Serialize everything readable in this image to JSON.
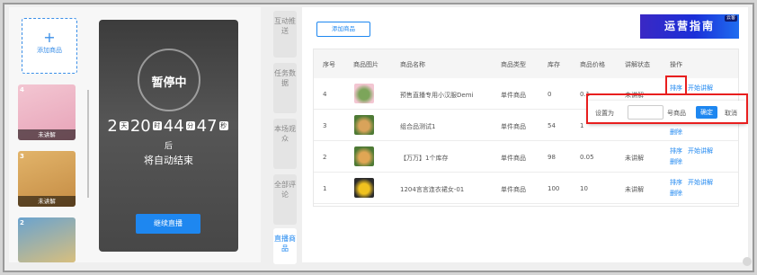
{
  "left": {
    "add_product_label": "添加商品",
    "items": [
      {
        "number": "4",
        "status": "未讲解",
        "color_a": "#f3c6d2",
        "color_b": "#e7a3b8"
      },
      {
        "number": "3",
        "status": "未讲解",
        "color_a": "#e2b46a",
        "color_b": "#c58c44"
      },
      {
        "number": "2",
        "status": "",
        "color_a": "#6aa3cf",
        "color_b": "#d8bf7e"
      }
    ]
  },
  "live": {
    "paused_text": "暂停中",
    "countdown": {
      "days": "2",
      "day_unit": "天",
      "hours": "20",
      "hour_unit": "时",
      "minutes": "44",
      "minute_unit": "分",
      "seconds": "47",
      "second_unit": "秒"
    },
    "after_text": "后",
    "auto_end_text": "将自动结束",
    "resume_button": "继续直播"
  },
  "tabs": [
    {
      "label": "互动推送",
      "active": false
    },
    {
      "label": "任务数据",
      "active": false
    },
    {
      "label": "本场观众",
      "active": false
    },
    {
      "label": "全部评论",
      "active": false
    },
    {
      "label": "直播商品",
      "active": true
    }
  ],
  "toolbar": {
    "add_product_button": "添加商品"
  },
  "guide_banner": {
    "text": "运营指南",
    "tag": "云客"
  },
  "table": {
    "headers": [
      "序号",
      "商品图片",
      "商品名称",
      "商品类型",
      "库存",
      "商品价格",
      "讲解状态",
      "操作"
    ],
    "rows": [
      {
        "index": "4",
        "name": "预售直播专用小汉服Demi",
        "type": "单件商品",
        "stock": "0",
        "price": "0.1",
        "status": "未讲解",
        "sort_label": "排序",
        "explain_label": "开始讲解",
        "delete_label": "",
        "img_a": "#f3c6d2",
        "img_b": "#7ca55a"
      },
      {
        "index": "3",
        "name": "组合品测试1",
        "type": "单件商品",
        "stock": "54",
        "price": "1",
        "status": "",
        "sort_label": "",
        "explain_label": "",
        "delete_label": "删除",
        "img_a": "#4e7a35",
        "img_b": "#d9a35a"
      },
      {
        "index": "2",
        "name": "【万万】1个库存",
        "type": "单件商品",
        "stock": "98",
        "price": "0.05",
        "status": "未讲解",
        "sort_label": "排序",
        "explain_label": "开始讲解",
        "delete_label": "删除",
        "img_a": "#4e7a35",
        "img_b": "#e0a654"
      },
      {
        "index": "1",
        "name": "1204言言连衣裙女-01",
        "type": "单件商品",
        "stock": "100",
        "price": "10",
        "status": "未讲解",
        "sort_label": "排序",
        "explain_label": "开始讲解",
        "delete_label": "删除",
        "img_a": "#2b2b2b",
        "img_b": "#f0c21f"
      }
    ]
  },
  "sort_popup": {
    "set_label": "设置为",
    "input_value": "",
    "suffix_label": "号商品",
    "confirm_button": "确定",
    "cancel_button": "取消"
  },
  "colors": {
    "accent": "#1e87f0",
    "highlight": "#e81e1e"
  }
}
